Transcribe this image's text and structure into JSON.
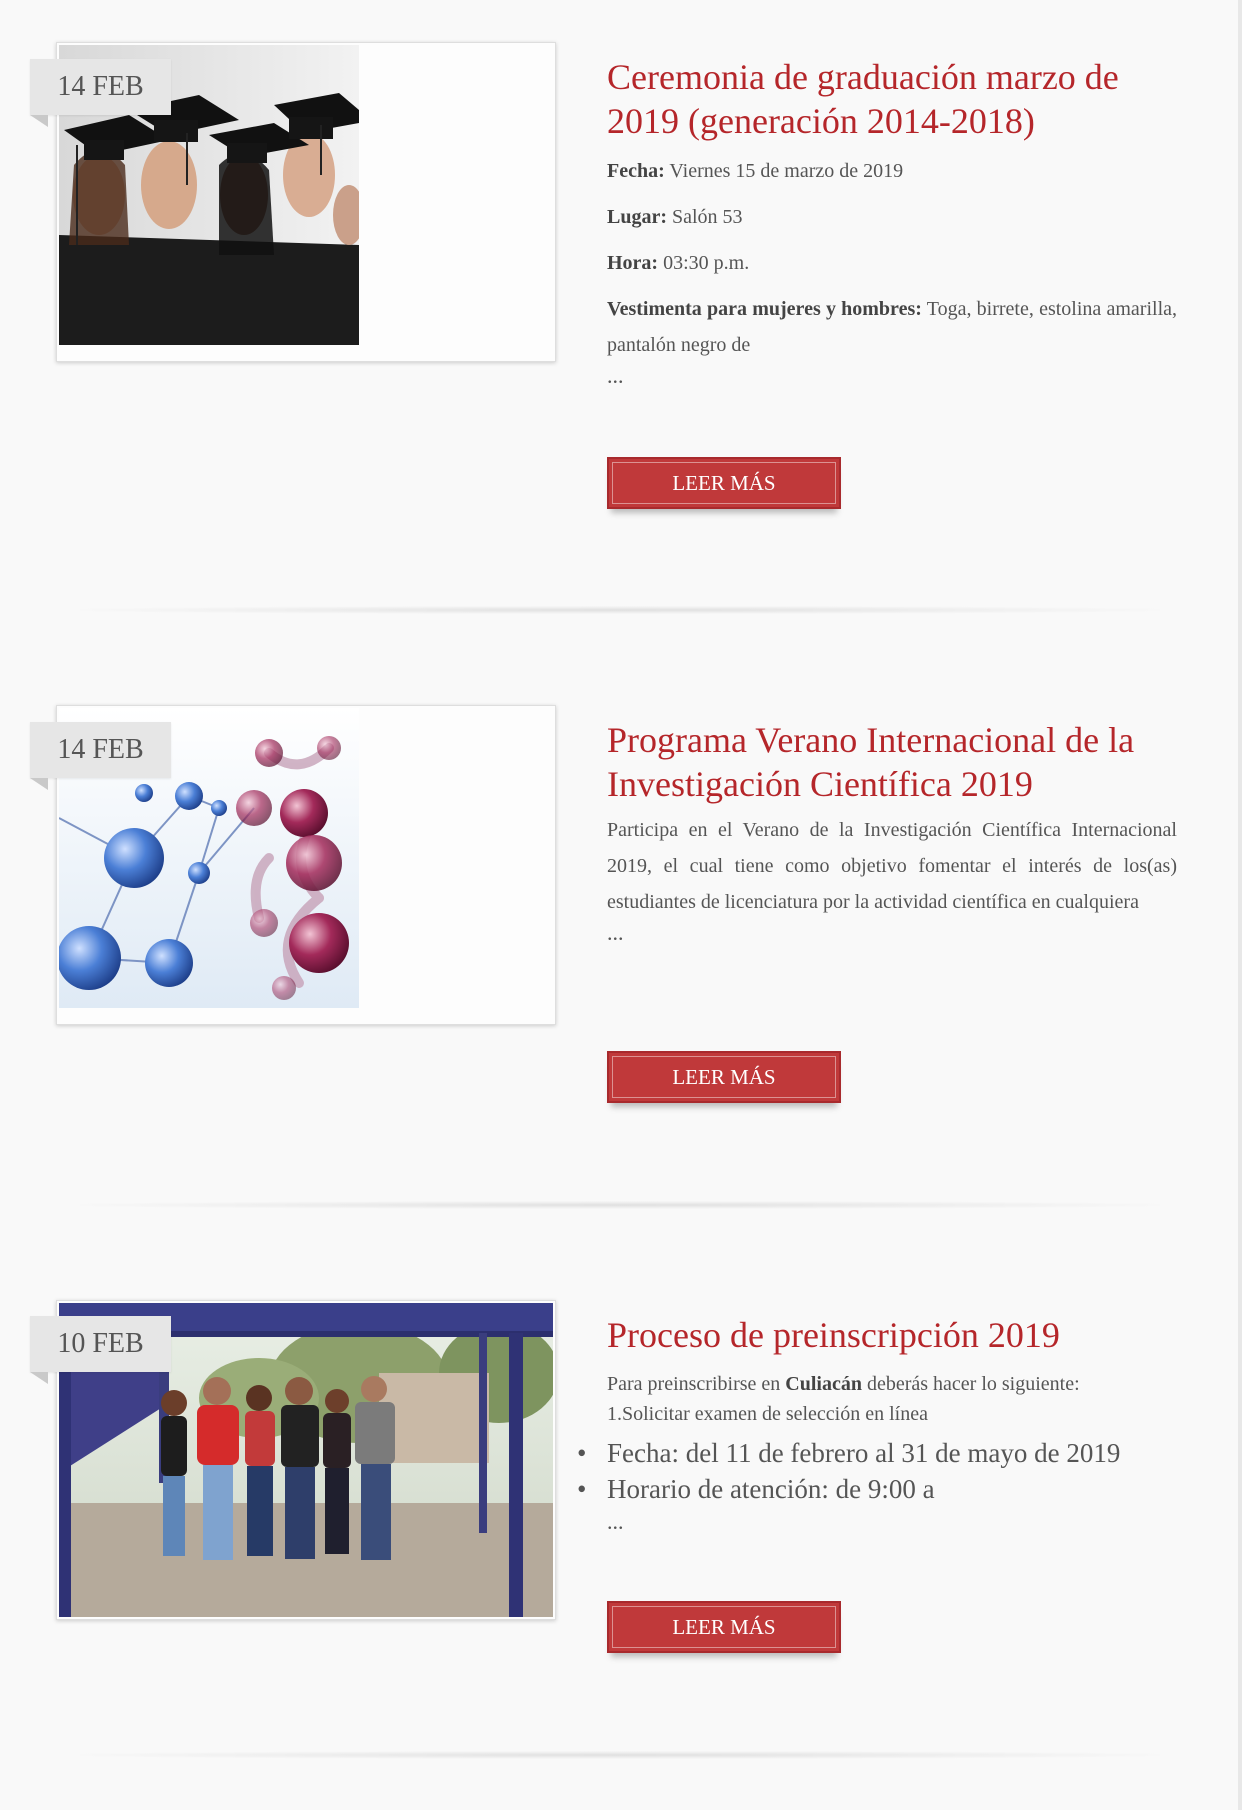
{
  "posts": [
    {
      "date": "14 FEB",
      "title": "Ceremonia de graduación marzo de 2019 (generación 2014-2018)",
      "fields": [
        {
          "label": "Fecha:",
          "value": " Viernes 15 de marzo de 2019"
        },
        {
          "label": "Lugar:",
          "value": " Salón 53"
        },
        {
          "label": "Hora:",
          "value": " 03:30 p.m."
        }
      ],
      "attire_label": "Vestimenta para mujeres y hombres:",
      "attire_value": " Toga, birrete, estolina amarilla, pantalón negro de",
      "ellipsis": "...",
      "button": "LEER MÁS",
      "image_icon": "graduates-photo"
    },
    {
      "date": "14 FEB",
      "title": "Programa Verano Internacional de la Investigación Científica 2019",
      "excerpt": "Participa en el Verano de la Investigación Científica Internacional 2019, el cual tiene como objetivo fomentar el interés de los(as) estudiantes de licenciatura por la actividad científica en cualquiera",
      "ellipsis": "...",
      "button": "LEER MÁS",
      "image_icon": "molecules-illustration"
    },
    {
      "date": "10 FEB",
      "title": "Proceso de preinscripción 2019",
      "intro_pre": "Para preinscribirse en ",
      "intro_bold": "Culiacán",
      "intro_post": " deberás hacer lo siguiente:",
      "step": "1.Solicitar examen de selección en línea",
      "bullets": [
        "Fecha: del 11 de febrero al 31 de mayo de 2019",
        "Horario de atención: de 9:00 a"
      ],
      "ellipsis": "...",
      "button": "LEER MÁS",
      "image_icon": "students-group-photo"
    }
  ],
  "colors": {
    "accent": "#b5262a",
    "button": "#c0393a",
    "background": "#f9f9f9",
    "badge": "#e6e6e6"
  }
}
